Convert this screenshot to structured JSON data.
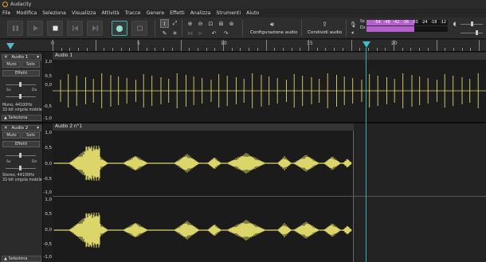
{
  "window": {
    "title": "Audacity"
  },
  "menu": [
    "File",
    "Modifica",
    "Seleziona",
    "Visualizza",
    "Attività",
    "Tracce",
    "Genere",
    "Effetti",
    "Analizza",
    "Strumenti",
    "Aiuto"
  ],
  "toolbar": {
    "audio_setup_label": "Configurazione audio",
    "share_audio_label": "Condividi audio",
    "meter_record_label": "Sx",
    "meter_play_label": "Dx",
    "meter_ticks": [
      "-54",
      "-48",
      "-42",
      "-36",
      "-30",
      "-24",
      "-18",
      "-12",
      "-6",
      "0"
    ]
  },
  "ruler": {
    "labels": [
      "0",
      "5",
      "10",
      "15",
      "20"
    ]
  },
  "tracks": [
    {
      "name": "Audio 1",
      "clip_name": "Audio 1",
      "mute_label": "Muto",
      "solo_label": "Solo",
      "effects_label": "Effetti",
      "left_label": "Sx",
      "right_label": "Dx",
      "info_line1": "Mono, 44100Hz",
      "info_line2": "32-bit virgola mobile",
      "select_label": "Seleziona",
      "scale": [
        "1,0",
        "0,5",
        "0,0",
        "-0,5",
        "-1,0"
      ]
    },
    {
      "name": "Audio 2",
      "clip_name": "Audio 2 n°1",
      "mute_label": "Muto",
      "solo_label": "Solo",
      "effects_label": "Effetti",
      "left_label": "Sx",
      "right_label": "Dx",
      "info_line1": "Stereo, 44100Hz",
      "info_line2": "32-bit virgola mobile",
      "select_label": "Seleziona",
      "scale_top": [
        "1,0",
        "0,5",
        "0,0",
        "-0,5",
        "-1,0"
      ],
      "scale_bottom": [
        "1,0",
        "0,5",
        "0,0",
        "-0,5",
        "-1,0"
      ]
    }
  ],
  "icons": {
    "pause": "pause-icon",
    "play": "play-icon",
    "stop": "stop-icon",
    "skip_start": "skip-to-start-icon",
    "skip_end": "skip-to-end-icon",
    "record": "record-icon",
    "loop": "loop-icon"
  },
  "colors": {
    "waveform": "#dcd66a",
    "accent": "#2fb3b3",
    "meter": "#b65fcf"
  }
}
